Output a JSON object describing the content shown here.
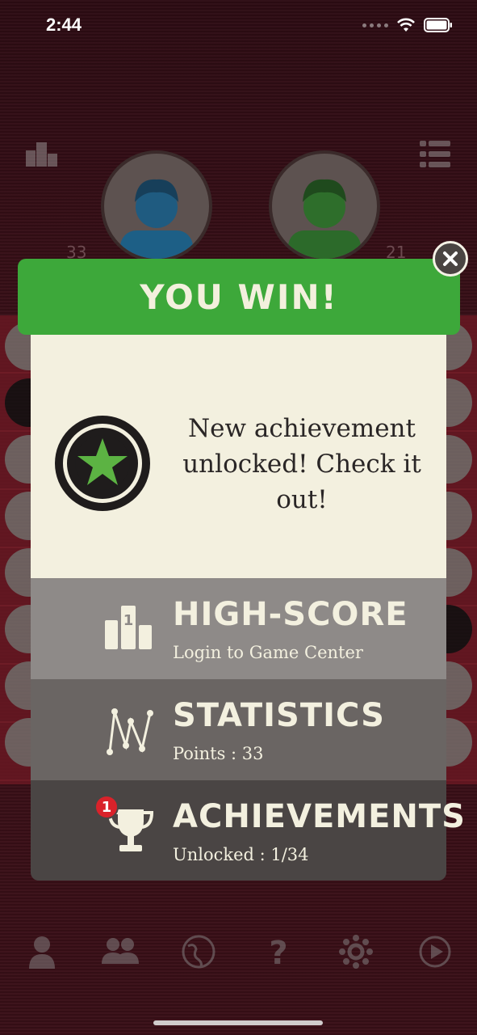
{
  "status_bar": {
    "time": "2:44"
  },
  "players": {
    "p1_score": "33",
    "p2_score": "21"
  },
  "modal": {
    "title": "YOU WIN!",
    "achievement_message": "New achievement unlocked! Check it out!",
    "rows": [
      {
        "title": "HIGH-SCORE",
        "subtitle": "Login to Game Center"
      },
      {
        "title": "STATISTICS",
        "subtitle": "Points : 33"
      },
      {
        "title": "ACHIEVEMENTS",
        "subtitle": "Unlocked : 1/34",
        "badge": "1"
      }
    ]
  },
  "colors": {
    "header_green": "#3da83a",
    "star_green": "#5cb343",
    "cream": "#f3f0df",
    "notification_red": "#d9222a"
  },
  "bottom_nav": [
    "profile-icon",
    "multiplayer-icon",
    "globe-icon",
    "help-icon",
    "settings-icon",
    "play-icon"
  ]
}
